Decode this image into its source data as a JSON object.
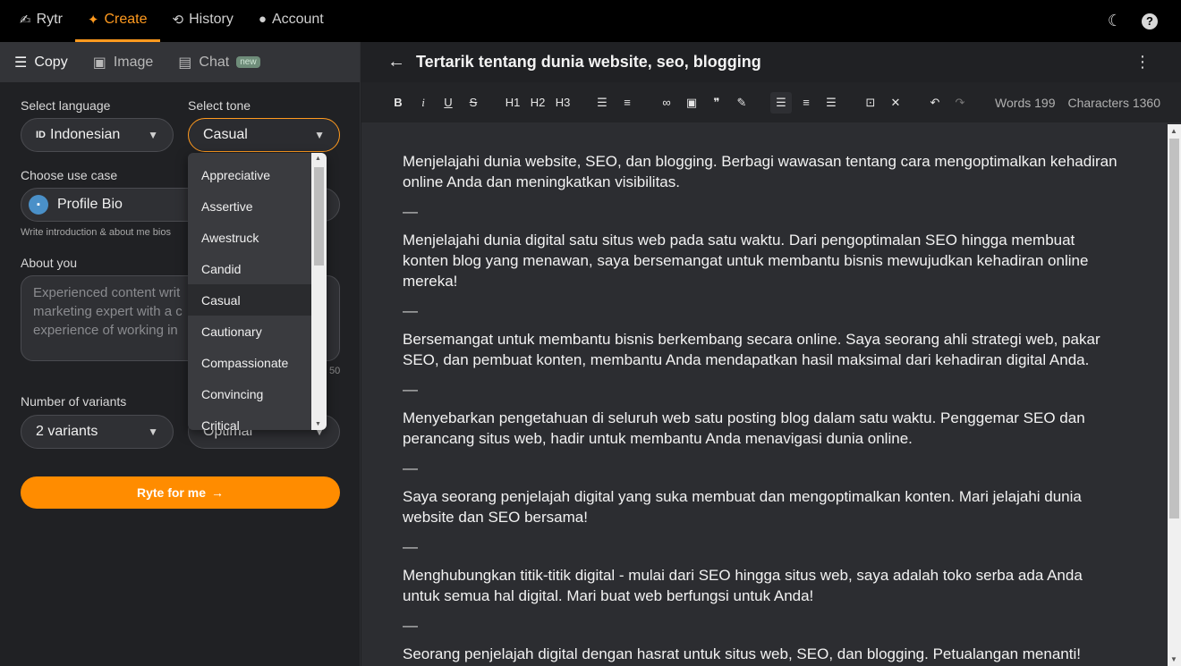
{
  "topnav": {
    "logo": "Rytr",
    "items": [
      {
        "label": "Create",
        "icon": "sparkle-icon"
      },
      {
        "label": "History",
        "icon": "history-icon"
      },
      {
        "label": "Account",
        "icon": "user-icon"
      }
    ]
  },
  "left": {
    "tabs": [
      {
        "label": "Copy",
        "icon": "lines-icon"
      },
      {
        "label": "Image",
        "icon": "image-icon"
      },
      {
        "label": "Chat",
        "icon": "chat-icon",
        "badge": "new"
      }
    ],
    "language_label": "Select language",
    "language_value": "ID Indonesian",
    "language_code": "ID",
    "language_name": "Indonesian",
    "tone_label": "Select tone",
    "tone_value": "Casual",
    "usecase_label": "Choose use case",
    "usecase_value": "Profile Bio",
    "usecase_hint": "Write introduction & about me bios",
    "about_label": "About you",
    "about_placeholder": "Experienced content writ… marketing expert with a c… experience of working in",
    "about_lines": [
      "Experienced content writ",
      "marketing expert with a c",
      "experience of working in"
    ],
    "counter": "50",
    "variants_label": "Number of variants",
    "variants_value": "2 variants",
    "creativity_value": "Optimal",
    "ryte_button": "Ryte for me"
  },
  "tone_dropdown": {
    "options": [
      "Appreciative",
      "Assertive",
      "Awestruck",
      "Candid",
      "Casual",
      "Cautionary",
      "Compassionate",
      "Convincing",
      "Critical"
    ],
    "selected": "Casual"
  },
  "editor": {
    "title": "Tertarik tentang dunia website, seo, blogging",
    "toolbar": {
      "bold": "B",
      "italic": "i",
      "underline": "U",
      "strike": "S",
      "h1": "H1",
      "h2": "H2",
      "h3": "H3"
    },
    "words": "Words 199",
    "characters": "Characters 1360",
    "separator": "—",
    "paragraphs": [
      "Menjelajahi dunia website, SEO, dan blogging. Berbagi wawasan tentang cara mengoptimalkan kehadiran online Anda dan meningkatkan visibilitas.",
      "Menjelajahi dunia digital satu situs web pada satu waktu. Dari pengoptimalan SEO hingga membuat konten blog yang menawan, saya bersemangat untuk membantu bisnis mewujudkan kehadiran online mereka!",
      "Bersemangat untuk membantu bisnis berkembang secara online. Saya seorang ahli strategi web, pakar SEO, dan pembuat konten, membantu Anda mendapatkan hasil maksimal dari kehadiran digital Anda.",
      "Menyebarkan pengetahuan di seluruh web satu posting blog dalam satu waktu. Penggemar SEO dan perancang situs web, hadir untuk membantu Anda menavigasi dunia online.",
      "Saya seorang penjelajah digital yang suka membuat dan mengoptimalkan konten. Mari jelajahi dunia website dan SEO bersama!",
      "Menghubungkan titik-titik digital - mulai dari SEO hingga situs web, saya adalah toko serba ada Anda untuk semua hal digital. Mari buat web berfungsi untuk Anda!",
      "Seorang penjelajah digital dengan hasrat untuk situs web, SEO, dan blogging. Petualangan menanti!"
    ]
  },
  "colors": {
    "accent": "#ff9a1f",
    "button": "#ff8c00",
    "editor_bg": "#2c2d31"
  }
}
